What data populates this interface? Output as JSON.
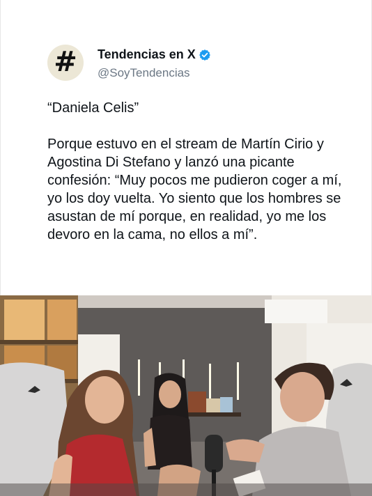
{
  "tweet": {
    "avatar_glyph": "#",
    "display_name": "Tendencias en X",
    "verified_icon": "verified-badge-icon",
    "handle": "@SoyTendencias",
    "title_quote": "“Daniela Celis”",
    "body": "Porque estuvo en el stream de Martín Cirio y Agostina Di Stefano y lanzó una picante confesión: “Muy pocos me pudieron coger a mí, yo los doy vuelta. Yo siento que los hombres se asustan de mí porque, en realidad, yo me los devoro en la cama, no ellos a mí”."
  },
  "colors": {
    "text": "#0f1419",
    "handle": "#6b7784",
    "verified": "#1d9bf0",
    "avatar_bg": "#ece7d6"
  }
}
